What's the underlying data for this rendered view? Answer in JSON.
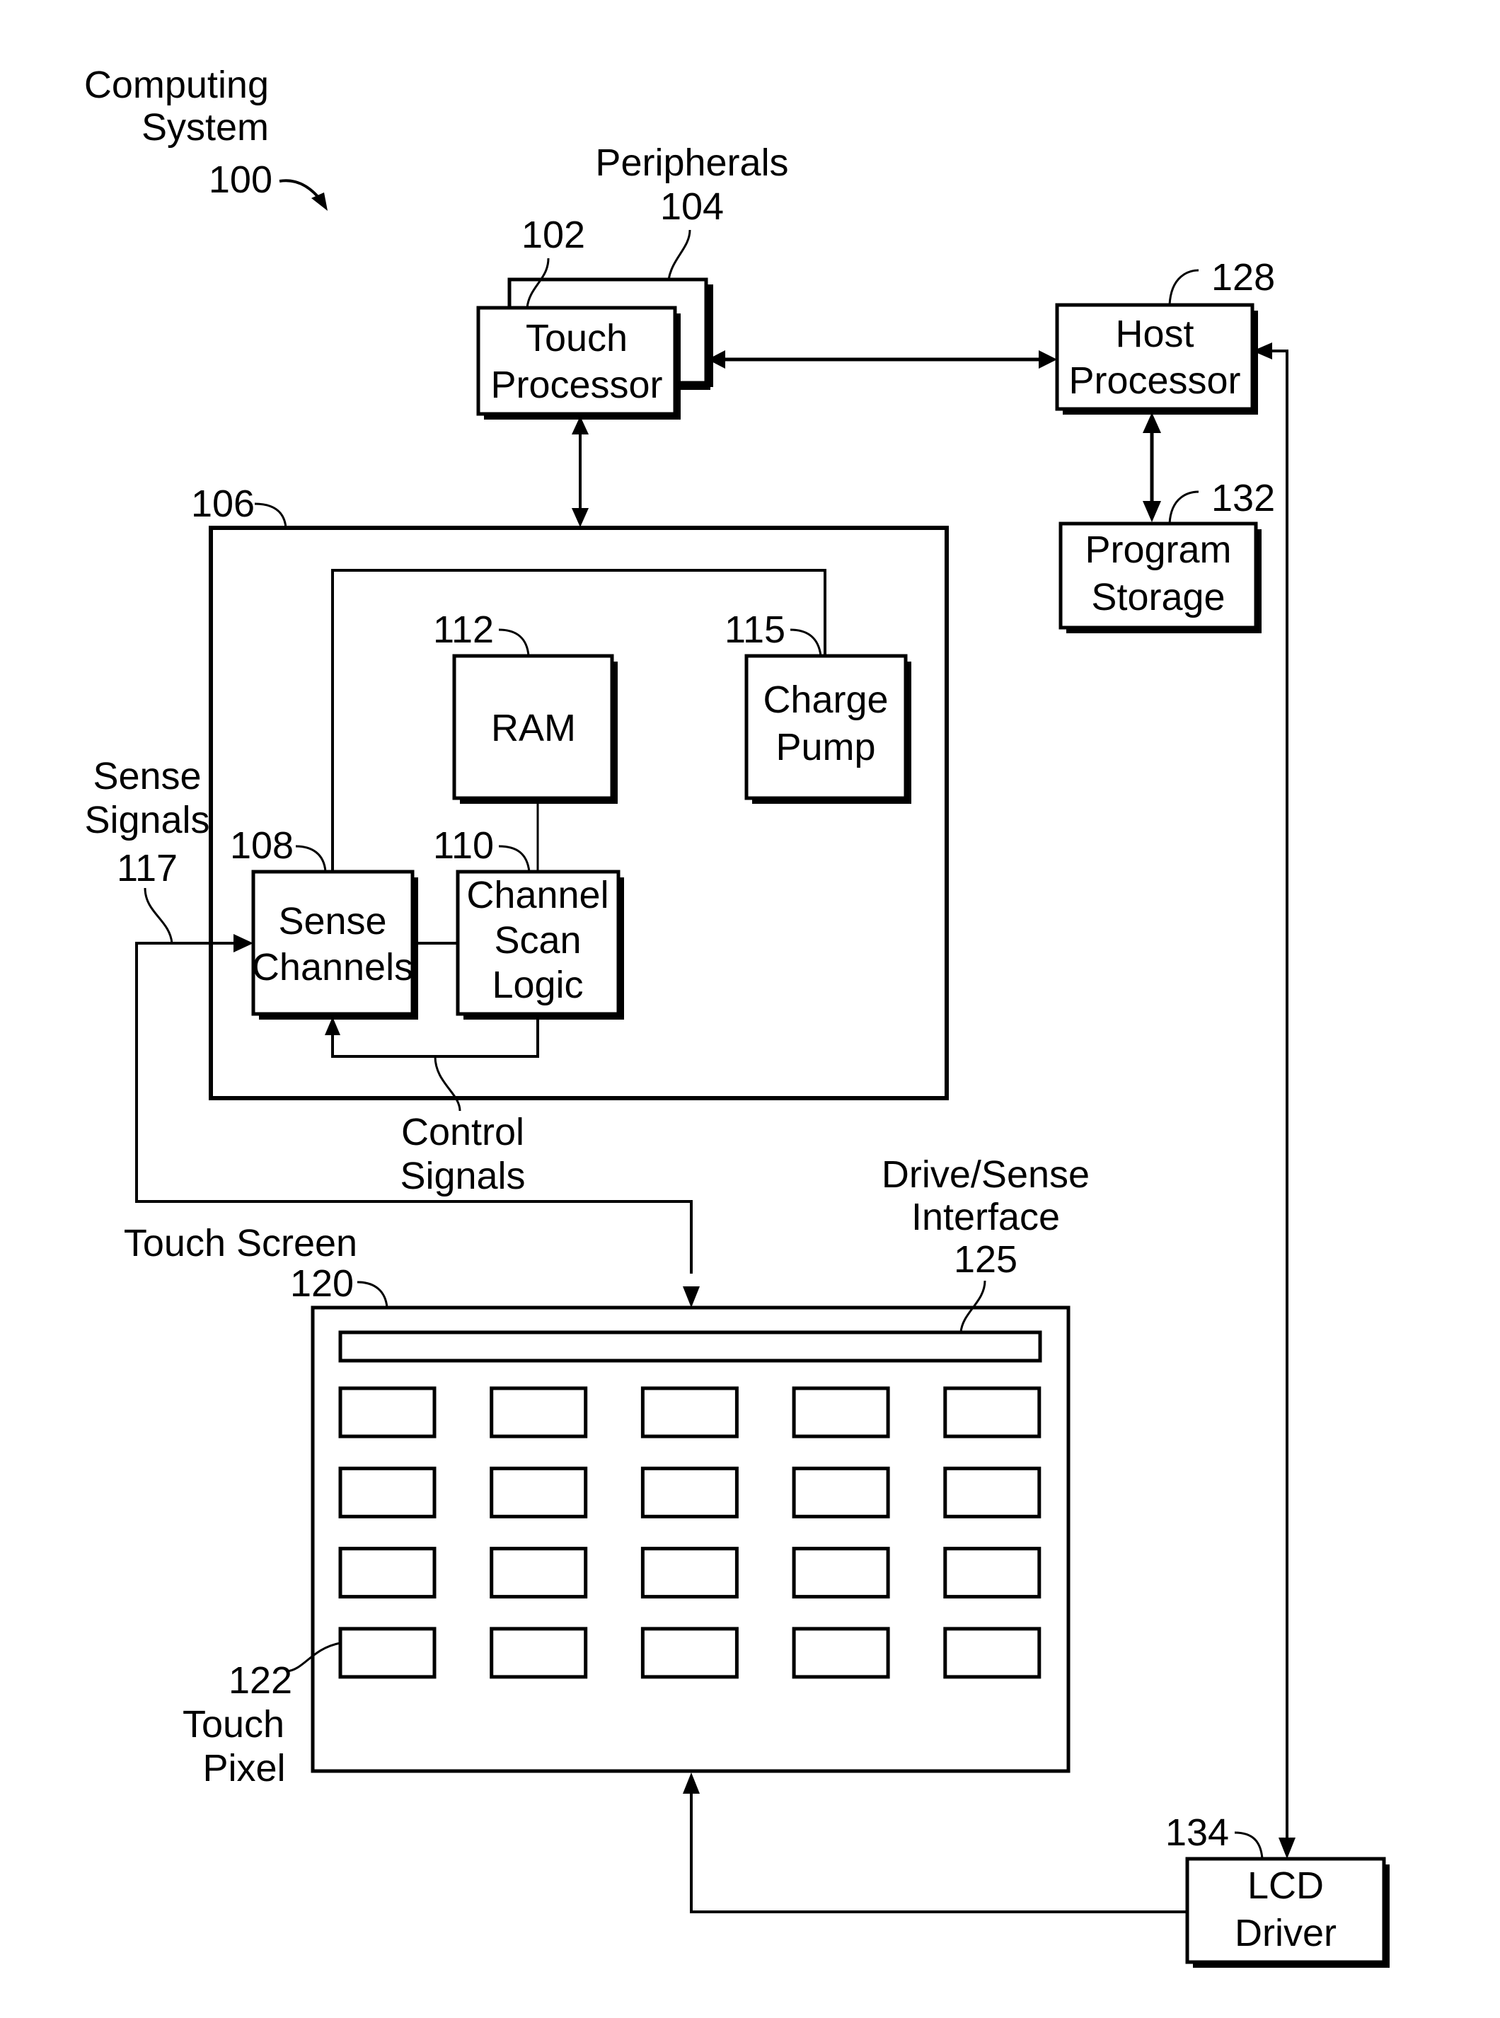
{
  "figure": {
    "title_line1": "Computing",
    "title_line2": "System",
    "ref": "100"
  },
  "blocks": {
    "touch_processor": {
      "line1": "Touch",
      "line2": "Processor",
      "ref": "102"
    },
    "peripherals": {
      "label": "Peripherals",
      "ref": "104"
    },
    "host_processor": {
      "line1": "Host",
      "line2": "Processor",
      "ref": "128"
    },
    "program_storage": {
      "line1": "Program",
      "line2": "Storage",
      "ref": "132"
    },
    "touch_subsystem": {
      "ref": "106"
    },
    "ram": {
      "label": "RAM",
      "ref": "112"
    },
    "charge_pump": {
      "line1": "Charge",
      "line2": "Pump",
      "ref": "115"
    },
    "sense_channels": {
      "line1": "Sense",
      "line2": "Channels",
      "ref": "108"
    },
    "channel_scan_logic": {
      "line1": "Channel",
      "line2": "Scan",
      "line3": "Logic",
      "ref": "110"
    },
    "touch_screen": {
      "label": "Touch Screen",
      "ref": "120"
    },
    "drive_sense_interface": {
      "line1": "Drive/Sense",
      "line2": "Interface",
      "ref": "125"
    },
    "touch_pixel": {
      "ref": "122",
      "line1": "Touch",
      "line2": "Pixel"
    },
    "lcd_driver": {
      "line1": "LCD",
      "line2": "Driver",
      "ref": "134"
    }
  },
  "signals": {
    "sense_signals": {
      "line1": "Sense",
      "line2": "Signals",
      "ref": "117"
    },
    "control_signals": {
      "line1": "Control",
      "line2": "Signals"
    }
  },
  "touch_pixel_grid": {
    "rows": 4,
    "cols": 5
  }
}
